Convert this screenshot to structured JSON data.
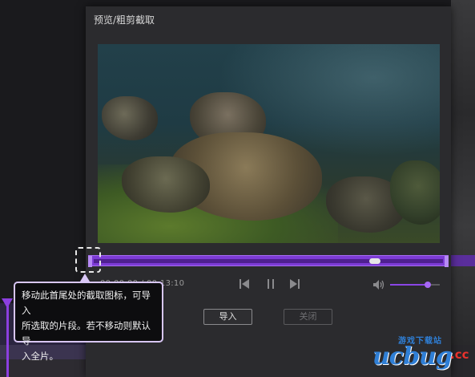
{
  "dialog": {
    "title": "预览/粗剪截取",
    "import_label": "导入",
    "close_label": "关闭"
  },
  "player": {
    "time_display": "00:00:00 / 00:13:10",
    "playhead_position": 0.82,
    "volume_level": 0.75
  },
  "tooltip": {
    "text_line1": "移动此首尾处的截取图标，可导入",
    "text_line2": "所选取的片段。若不移动则默认导",
    "text_line3": "入全片。"
  },
  "watermark": {
    "brand": "ucbug",
    "suffix": ".cc",
    "tagline": "游戏下载站"
  },
  "colors": {
    "accent": "#7d3bd6",
    "tooltip_border": "#d8c6f5",
    "watermark_blue": "#2f7fd6",
    "watermark_red": "#e8322c"
  },
  "icons": [
    "prev-frame-icon",
    "pause-icon",
    "next-frame-icon",
    "volume-icon"
  ]
}
